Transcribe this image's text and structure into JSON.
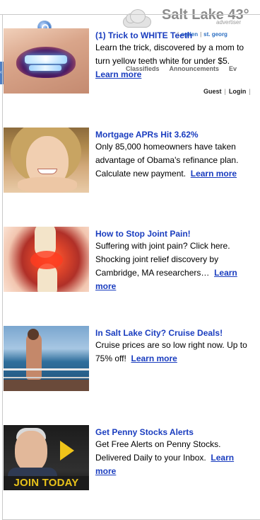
{
  "site_header": {
    "city": "Salt Lake",
    "temperature": "43°",
    "advertiser_label": "advertiser",
    "city_links": [
      "ogden",
      "st. georg"
    ],
    "nav_tabs": [
      "Classifieds",
      "Announcements",
      "Ev"
    ],
    "user_links": [
      "Guest",
      "Login"
    ]
  },
  "ads": [
    {
      "title": "(1) Trick to WHITE Teeth",
      "body": "Learn the trick, discovered by a mom to turn yellow teeth white for under $5.",
      "more": "Learn more",
      "image": "teeth-whitening-photo"
    },
    {
      "title": "Mortgage APRs Hit 3.62%",
      "body": "Only 85,000 homeowners have taken advantage of Obama's refinance plan. Calculate new payment.",
      "more": "Learn more",
      "image": "smiling-woman-photo"
    },
    {
      "title": "How to Stop Joint Pain!",
      "body": "Suffering with joint pain? Click here. Shocking joint relief discovery by Cambridge, MA researchers…",
      "more": "Learn more",
      "image": "knee-joint-illustration"
    },
    {
      "title": "In Salt Lake City? Cruise Deals!",
      "body": "Cruise prices are so low right now. Up to 75% off!",
      "more": "Learn more",
      "image": "cruise-deck-photo"
    },
    {
      "title": "Get Penny Stocks Alerts",
      "body": "Get Free Alerts on Penny Stocks. Delivered Daily to your Inbox.",
      "more": "Learn more",
      "image": "penny-stocks-banner",
      "image_caption": "JOIN TODAY"
    }
  ],
  "colors": {
    "link_blue": "#1a3dbf",
    "header_gray": "#8c8c8c",
    "join_yellow": "#e8c21a"
  }
}
